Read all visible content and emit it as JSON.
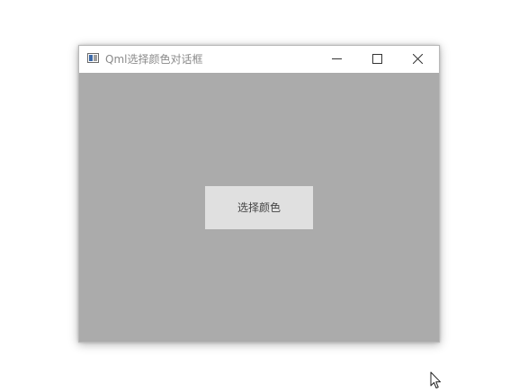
{
  "window": {
    "title": "Qml选择颜色对话框",
    "controls": {
      "minimize_icon": "minimize-icon",
      "maximize_icon": "maximize-icon",
      "close_icon": "close-icon"
    }
  },
  "main": {
    "pick_color_label": "选择颜色"
  },
  "colors": {
    "client_background": "#ababab",
    "titlebar_background": "#ffffff",
    "button_background": "#e0e0e0",
    "title_text": "#8a8a8a"
  },
  "icons": {
    "app": "app-window-icon",
    "cursor": "mouse-pointer-icon"
  }
}
